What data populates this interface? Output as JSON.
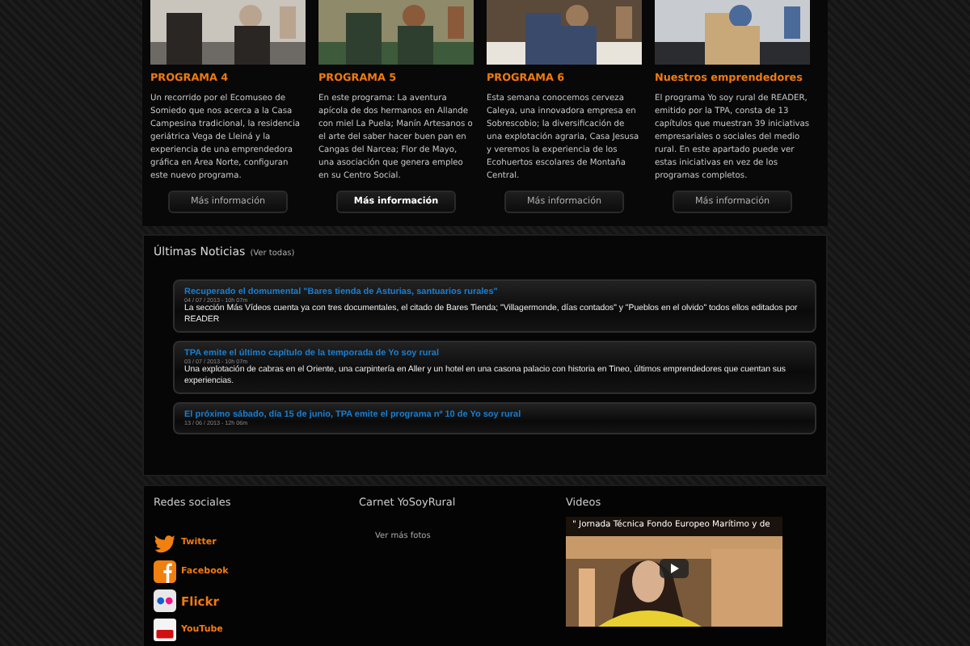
{
  "programs": [
    {
      "kind": "picture",
      "title": "PROGRAMA 4",
      "text": "Un recorrido por el Ecomuseo de Somiedo que nos acerca a la Casa Campesina tradicional, la residencia geriátrica Vega de Lleiná y la experiencia de una emprendedora gráfica en Área Norte, configuran este nuevo programa.",
      "button": {
        "label": "Más información",
        "selected": false
      }
    },
    {
      "kind": "picture",
      "title": "PROGRAMA 5",
      "text": "En este programa: La aventura apícola de dos hermanos en Allande con miel La Puela; Manín Artesanos o el arte del saber hacer buen pan en Cangas del Narcea; Flor de Mayo, una asociación que genera empleo en su Centro Social.",
      "button": {
        "label": "Más información",
        "selected": true
      }
    },
    {
      "kind": "picture",
      "title": "PROGRAMA 6",
      "text": "Esta semana conocemos cerveza Caleya, una innovadora empresa en Sobrescobio; la diversificación de una explotación agraria, Casa Jesusa y veremos la experiencia de los Ecohuertos escolares de Montaña Central.",
      "button": {
        "label": "Más información",
        "selected": false
      }
    },
    {
      "kind": "picture",
      "title": "Nuestros emprendedores",
      "text": "El programa Yo soy rural de READER, emitido por la TPA, consta de 13 capítulos que muestran 39 iniciativas empresariales o sociales del medio rural. En este apartado puede ver estas iniciativas en vez de los programas completos.",
      "button": {
        "label": "Más información",
        "selected": false
      }
    }
  ],
  "news": {
    "title": "Últimas Noticias",
    "link": "(Ver todas)",
    "items": [
      {
        "title": "Recuperado el domumental \"Bares tienda de Asturias, santuarios rurales\"",
        "date": "04 / 07 / 2013 - 10h 07m",
        "text": "La sección Más Vídeos cuenta ya con tres documentales, el citado de Bares Tienda; \"Villagermonde, días contados\" y \"Pueblos en el olvido\" todos ellos editados por READER"
      },
      {
        "title": "TPA emite el último capítulo de la temporada de Yo soy rural",
        "date": "03 / 07 / 2013 - 10h 07m",
        "text": "Una explotación de cabras en el Oriente, una carpintería en Aller y un hotel en una casona palacio con historia en Tineo, últimos emprendedores que cuentan sus experiencias."
      },
      {
        "title": "El próximo sábado, día 15 de junio, TPA emite el programa nº 10 de Yo soy rural",
        "date": "13 / 06 / 2013 - 12h 06m"
      }
    ]
  },
  "footer": {
    "social": {
      "title": "Redes sociales",
      "items": [
        {
          "kind": "twitter",
          "label": "Twitter"
        },
        {
          "kind": "facebook",
          "label": "Facebook"
        },
        {
          "kind": "flickr",
          "label": "Flickr"
        },
        {
          "kind": "youtube",
          "label": "YouTube"
        }
      ]
    },
    "carnet": {
      "title": "Carnet YoSoyRural",
      "link": "Ver más fotos"
    },
    "videos": {
      "title": "Videos",
      "video_title": "\" Jornada Técnica Fondo Europeo Marítimo y de"
    }
  }
}
